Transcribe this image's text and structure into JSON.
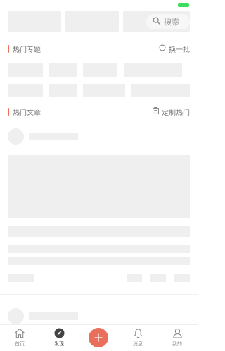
{
  "status_bar": {
    "battery_color": "#3ddc5b"
  },
  "search": {
    "placeholder": "搜索",
    "icon": "search-icon"
  },
  "hot_topics": {
    "title": "热门专题",
    "action_label": "换一批",
    "action_icon": "refresh-icon"
  },
  "hot_articles": {
    "title": "热门文章",
    "action_label": "定制热门",
    "action_icon": "clipboard-icon"
  },
  "tabbar": {
    "items": [
      {
        "label": "首页",
        "icon": "home-icon"
      },
      {
        "label": "发现",
        "icon": "compass-icon",
        "active": true
      },
      {
        "label": "",
        "icon": "plus-icon"
      },
      {
        "label": "消息",
        "icon": "bell-icon"
      },
      {
        "label": "我的",
        "icon": "user-icon"
      }
    ]
  },
  "colors": {
    "accent": "#ea6f5a",
    "placeholder": "#efefef",
    "muted_text": "#777777"
  }
}
